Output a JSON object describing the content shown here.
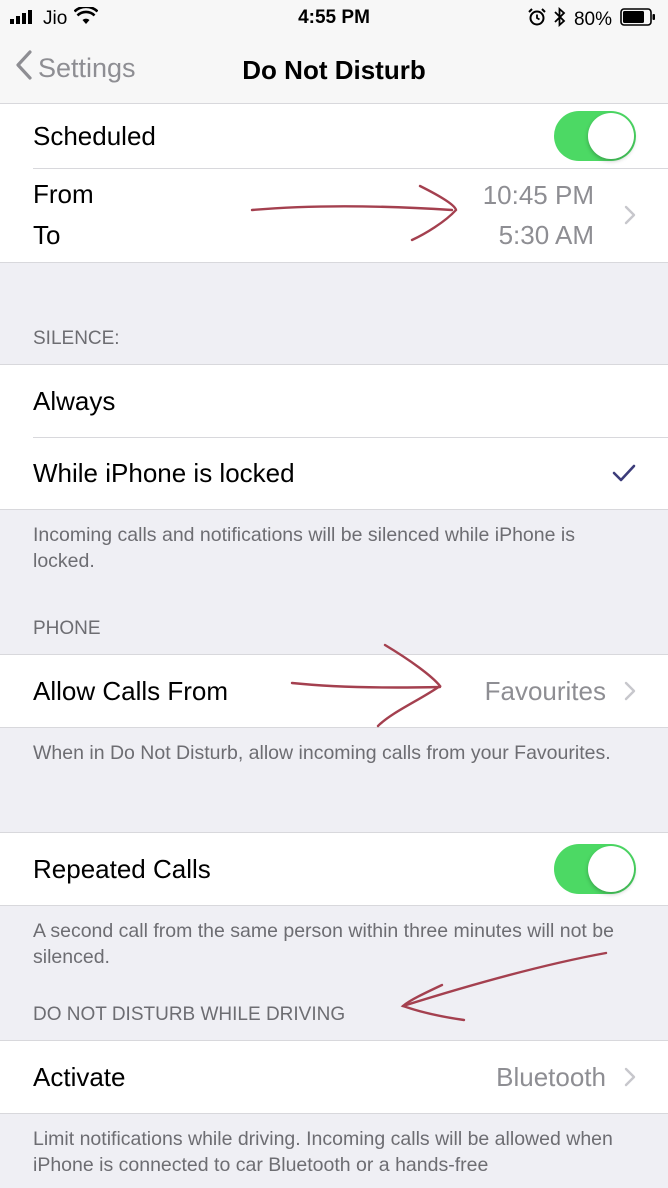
{
  "status_bar": {
    "carrier": "Jio",
    "time": "4:55 PM",
    "battery": "80%",
    "icons": [
      "signal-bars-icon",
      "wifi-icon",
      "alarm-icon",
      "bluetooth-icon",
      "battery-icon"
    ]
  },
  "nav": {
    "back_label": "Settings",
    "title": "Do Not Disturb"
  },
  "schedule": {
    "scheduled_label": "Scheduled",
    "scheduled_on": true,
    "from_label": "From",
    "to_label": "To",
    "from_time": "10:45 PM",
    "to_time": "5:30 AM"
  },
  "silence": {
    "header": "SILENCE:",
    "options": [
      "Always",
      "While iPhone is locked"
    ],
    "selected": "While iPhone is locked",
    "footer": "Incoming calls and notifications will be silenced while iPhone is locked."
  },
  "phone": {
    "header": "PHONE",
    "allow_calls_label": "Allow Calls From",
    "allow_calls_value": "Favourites",
    "allow_calls_footer": "When in Do Not Disturb, allow incoming calls from your Favourites.",
    "repeated_calls_label": "Repeated Calls",
    "repeated_calls_on": true,
    "repeated_calls_footer": "A second call from the same person within three minutes will not be silenced."
  },
  "driving": {
    "header": "DO NOT DISTURB WHILE DRIVING",
    "activate_label": "Activate",
    "activate_value": "Bluetooth",
    "footer": "Limit notifications while driving. Incoming calls will be allowed when iPhone is connected to car Bluetooth or a hands-free"
  },
  "colors": {
    "toggle_on": "#4cd964",
    "annotation": "#a4404f",
    "secondary_text": "#8e8e93"
  }
}
